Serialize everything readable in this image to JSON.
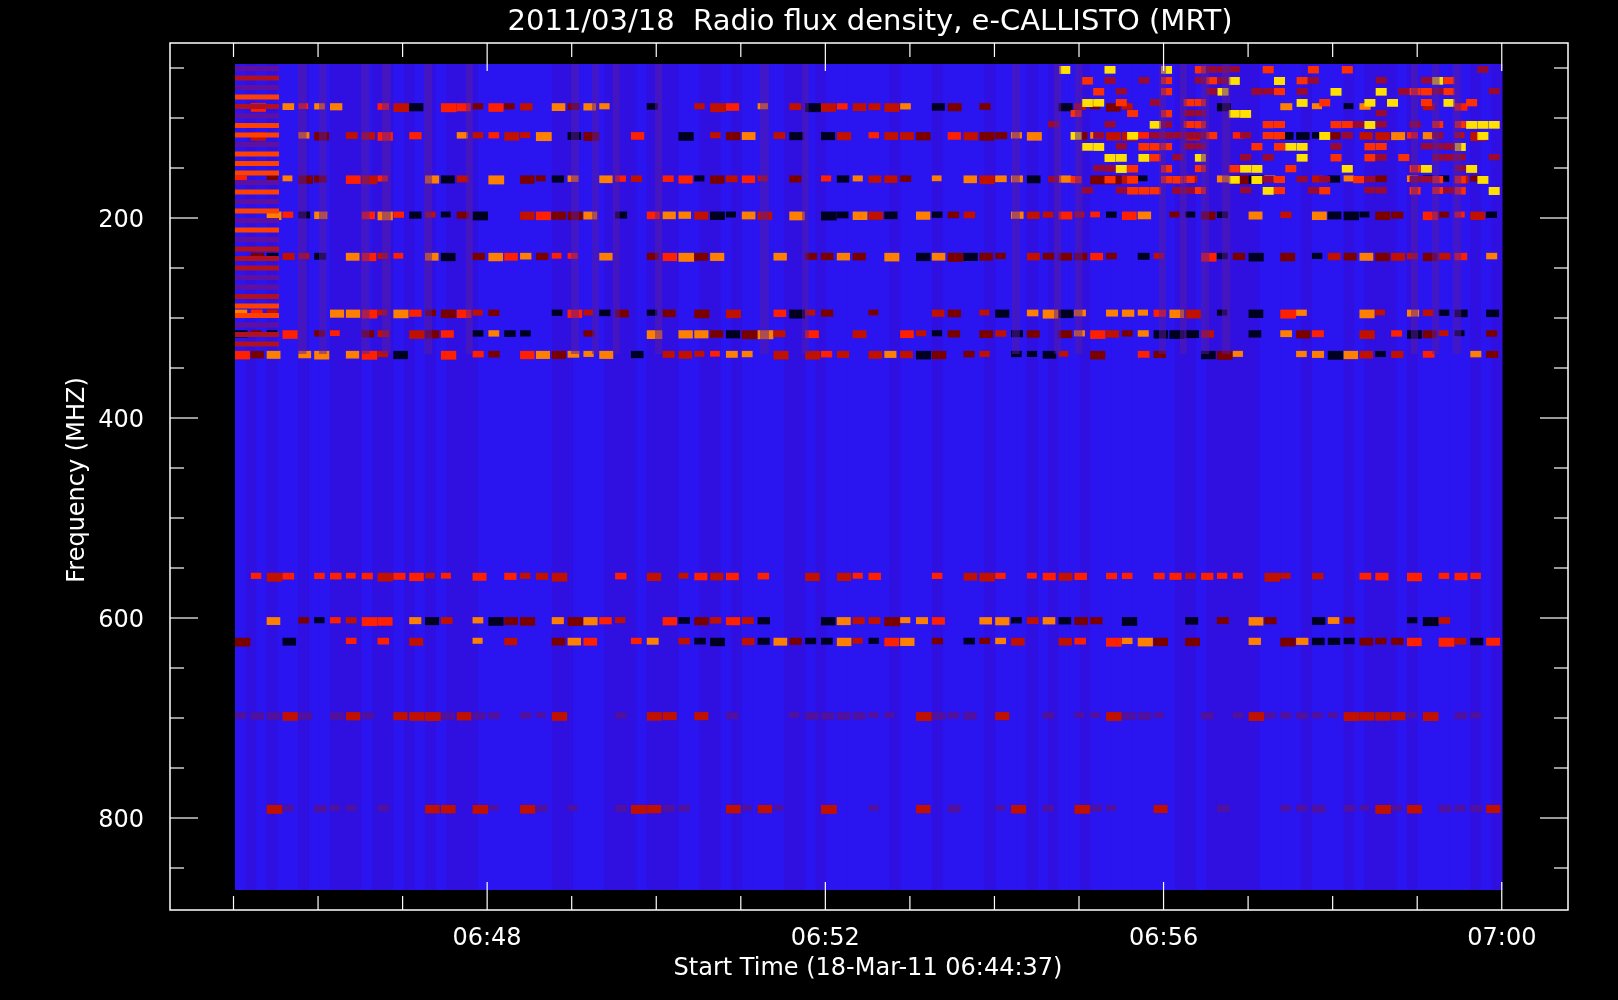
{
  "title": "2011/03/18  Radio flux density, e-CALLISTO (MRT)",
  "ylabel": "Frequency (MHZ)",
  "xlabel": "Start Time (18-Mar-11 06:44:37)",
  "yticks": [
    "200",
    "400",
    "600",
    "800"
  ],
  "xticks": [
    "06:48",
    "06:52",
    "06:56",
    "07:00"
  ]
}
